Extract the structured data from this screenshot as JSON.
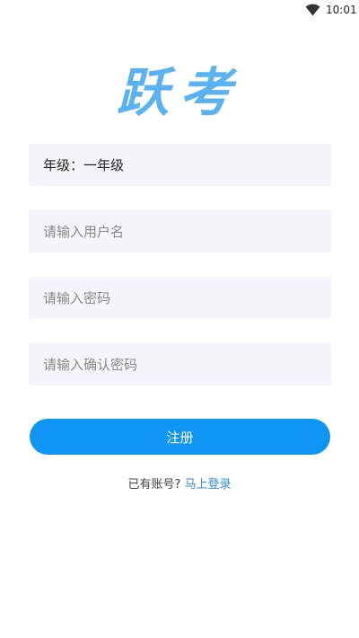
{
  "status_bar": {
    "time": "10:01",
    "wifi_icon": "wifi-icon"
  },
  "logo": {
    "text": "跃考",
    "color": "#5ab3f0"
  },
  "form": {
    "grade_value": "年级：一年级",
    "username_placeholder": "请输入用户名",
    "password_placeholder": "请输入密码",
    "confirm_placeholder": "请输入确认密码"
  },
  "register_button": {
    "label": "注册",
    "color": "#0f95f3"
  },
  "login_prompt": {
    "text": "已有账号?",
    "link": "马上登录",
    "link_color": "#2e8ee0"
  }
}
